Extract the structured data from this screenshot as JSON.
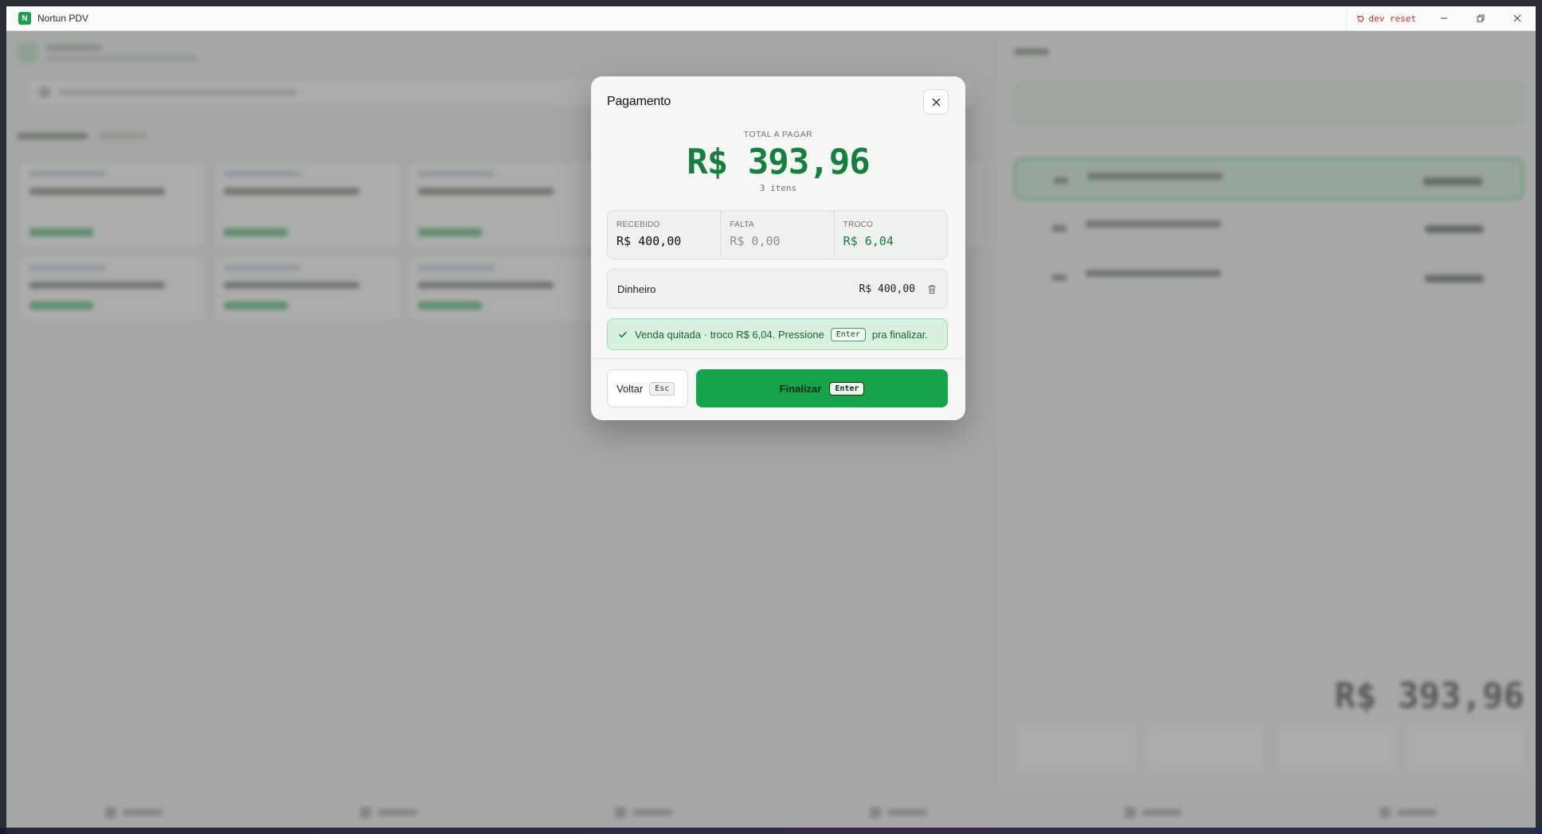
{
  "window": {
    "title": "Nortun PDV",
    "logo_letter": "N",
    "dev_reset_label": "dev reset"
  },
  "background": {
    "pos_total": "R$ 393,96"
  },
  "payment_modal": {
    "title": "Pagamento",
    "total_label": "TOTAL A PAGAR",
    "total_value": "R$ 393,96",
    "items_count": "3 itens",
    "summary": {
      "received_label": "RECEBIDO",
      "received_value": "R$ 400,00",
      "missing_label": "FALTA",
      "missing_value": "R$ 0,00",
      "change_label": "TROCO",
      "change_value": "R$ 6,04"
    },
    "payment_line": {
      "method": "Dinheiro",
      "amount": "R$ 400,00"
    },
    "status": {
      "text": "Venda quitada · troco R$ 6,04. Pressione",
      "key": "Enter",
      "suffix": "pra finalizar."
    },
    "back_button": {
      "label": "Voltar",
      "key": "Esc"
    },
    "finalize_button": {
      "label": "Finalizar",
      "key": "Enter"
    }
  },
  "colors": {
    "accent": "#16a34a",
    "total_green": "#15803d",
    "danger": "#dc2626"
  }
}
